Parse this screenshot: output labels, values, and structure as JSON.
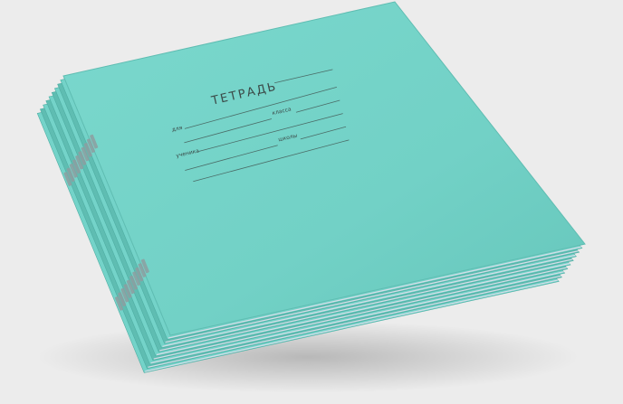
{
  "photo": {
    "background_color": "#ececec",
    "object": "stack of school exercise notebooks",
    "notebook_count": 9,
    "cover_color": "#74d3c9",
    "cover_edge_color": "#5fbdb2",
    "page_edge_color": "#d8dde8",
    "staple_color": "#8d9ea0"
  },
  "cover": {
    "title": "ТЕТРАДЬ",
    "field_for": "для",
    "field_class": "класса",
    "field_student": "ученика",
    "field_school": "школы"
  }
}
